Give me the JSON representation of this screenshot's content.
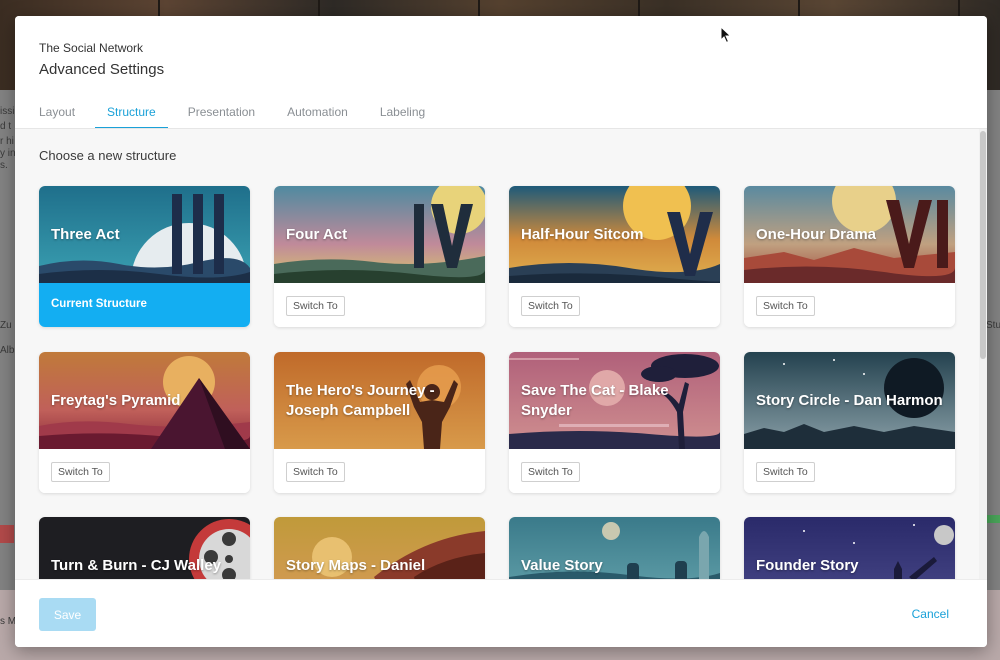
{
  "background": {
    "snippets": [
      "issi",
      "d t",
      "r hi",
      "y in",
      "s.",
      "Zu",
      "Alb",
      "Stu",
      "s M"
    ]
  },
  "modal": {
    "project_name": "The Social Network",
    "title": "Advanced Settings",
    "tabs": [
      {
        "label": "Layout",
        "active": false
      },
      {
        "label": "Structure",
        "active": true
      },
      {
        "label": "Presentation",
        "active": false
      },
      {
        "label": "Automation",
        "active": false
      },
      {
        "label": "Labeling",
        "active": false
      }
    ],
    "section_heading": "Choose a new structure",
    "switch_label": "Switch To",
    "current_label": "Current Structure",
    "structures": [
      {
        "name": "Three Act",
        "current": true
      },
      {
        "name": "Four Act",
        "current": false
      },
      {
        "name": "Half-Hour Sitcom",
        "current": false
      },
      {
        "name": "One-Hour Drama",
        "current": false
      },
      {
        "name": "Freytag's Pyramid",
        "current": false
      },
      {
        "name": "The Hero's Journey - Joseph Campbell",
        "current": false
      },
      {
        "name": "Save The Cat - Blake Snyder",
        "current": false
      },
      {
        "name": "Story Circle - Dan Harmon",
        "current": false
      },
      {
        "name": "Turn & Burn - CJ Walley",
        "current": false
      },
      {
        "name": "Story Maps - Daniel Calvisi",
        "current": false
      },
      {
        "name": "Value Story",
        "current": false
      },
      {
        "name": "Founder Story",
        "current": false
      }
    ],
    "footer": {
      "save_label": "Save",
      "cancel_label": "Cancel"
    }
  },
  "colors": {
    "accent": "#1aa1d8",
    "current_structure": "#13aef2",
    "save_disabled": "#a9dbf3"
  }
}
